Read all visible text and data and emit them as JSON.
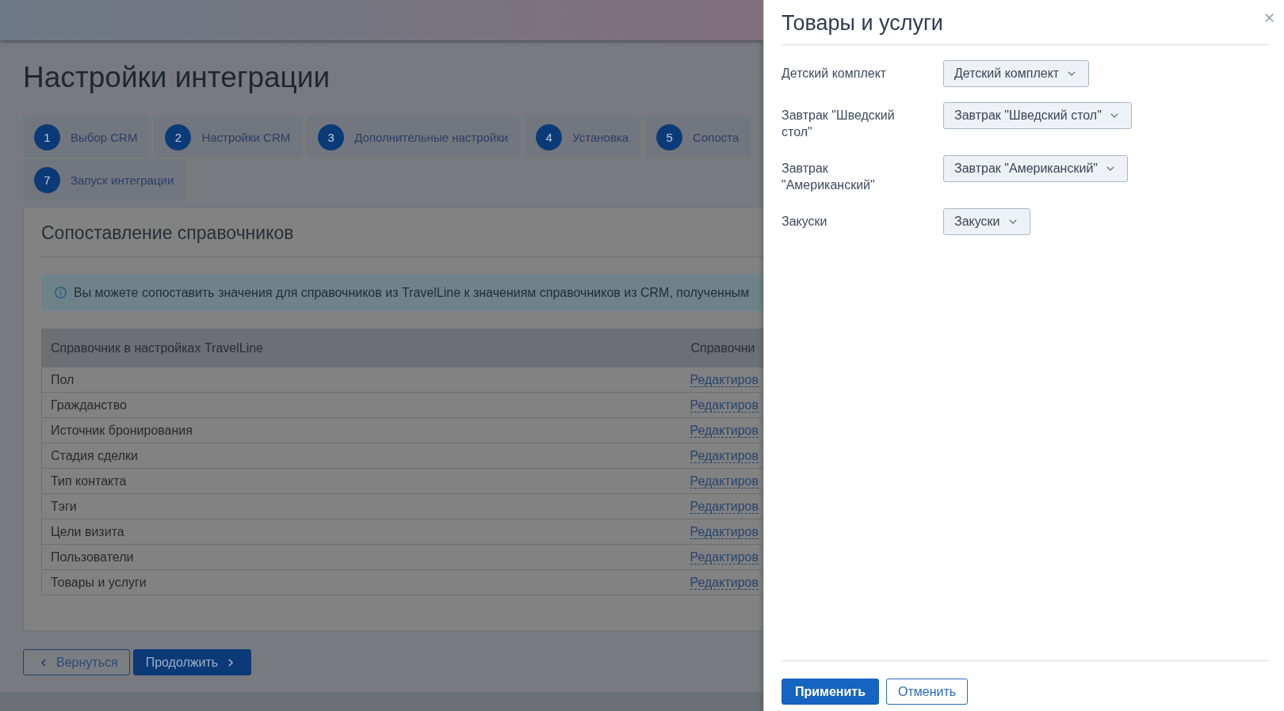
{
  "page": {
    "title": "Настройки интеграции",
    "steps": [
      {
        "number": "1",
        "label": "Выбор CRM"
      },
      {
        "number": "2",
        "label": "Настройки CRM"
      },
      {
        "number": "3",
        "label": "Дополнительные настройки"
      },
      {
        "number": "4",
        "label": "Установка"
      },
      {
        "number": "5",
        "label": "Сопоста"
      },
      {
        "number": "7",
        "label": "Запуск интеграции"
      }
    ]
  },
  "section": {
    "title": "Сопоставление справочников",
    "info": "Вы можете сопоставить значения для справочников из TravelLine к значениям справочников из CRM, полученным",
    "table": {
      "columns": [
        "Справочник в настройках TravelLine",
        "Справочни"
      ],
      "rows": [
        {
          "name": "Пол",
          "action": "Редактиров"
        },
        {
          "name": "Гражданство",
          "action": "Редактиров"
        },
        {
          "name": "Источник бронирования",
          "action": "Редактиров"
        },
        {
          "name": "Стадия сделки",
          "action": "Редактиров"
        },
        {
          "name": "Тип контакта",
          "action": "Редактиров"
        },
        {
          "name": "Тэги",
          "action": "Редактиров"
        },
        {
          "name": "Цели визита",
          "action": "Редактиров"
        },
        {
          "name": "Пользователи",
          "action": "Редактиров"
        },
        {
          "name": "Товары и услуги",
          "action": "Редактиров"
        }
      ]
    }
  },
  "nav_buttons": [
    {
      "label": "Вернуться",
      "kind": "back"
    },
    {
      "label": "Продолжить",
      "kind": "next"
    }
  ],
  "panel": {
    "title": "Товары и услуги",
    "fields": [
      {
        "label": "Детский комплект",
        "value": "Детский комплект"
      },
      {
        "label": "Завтрак \"Шведский стол\"",
        "value": "Завтрак \"Шведский стол\""
      },
      {
        "label": "Завтрак \"Американский\"",
        "value": "Завтрак \"Американский\""
      },
      {
        "label": "Закуски",
        "value": "Закуски"
      }
    ],
    "buttons": [
      {
        "label": "Применить",
        "kind": "primary"
      },
      {
        "label": "Отменить",
        "kind": "secondary"
      }
    ]
  }
}
